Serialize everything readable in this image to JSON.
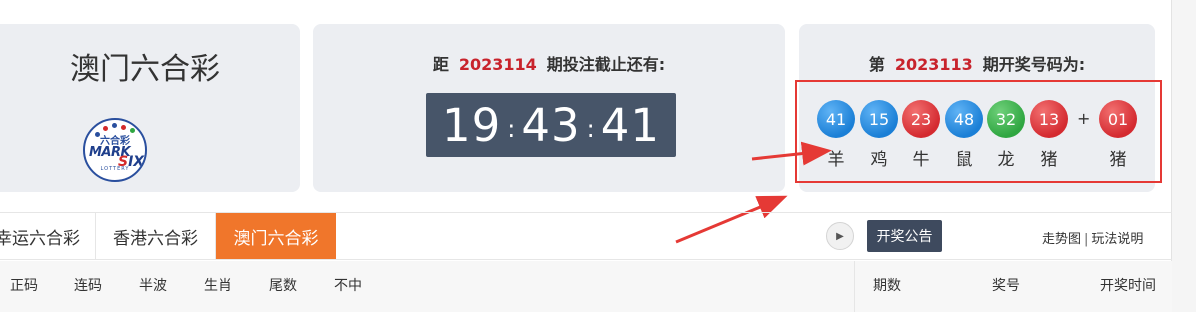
{
  "brand": {
    "title": "澳门六合彩",
    "logo_top": "六合彩",
    "logo_mark": "MARK",
    "logo_six_s": "S",
    "logo_six_rest": "IX",
    "logo_sub": "LOTTERY"
  },
  "countdown": {
    "prefix": "距",
    "issue": "2023114",
    "suffix": "期投注截止还有:",
    "hours": "19",
    "minutes": "43",
    "seconds": "41"
  },
  "result": {
    "prefix": "第",
    "issue": "2023113",
    "suffix": "期开奖号码为:",
    "plus": "+",
    "balls": [
      {
        "num": "41",
        "zodiac": "羊",
        "color": "blue"
      },
      {
        "num": "15",
        "zodiac": "鸡",
        "color": "blue"
      },
      {
        "num": "23",
        "zodiac": "牛",
        "color": "red"
      },
      {
        "num": "48",
        "zodiac": "鼠",
        "color": "blue"
      },
      {
        "num": "32",
        "zodiac": "龙",
        "color": "green"
      },
      {
        "num": "13",
        "zodiac": "猪",
        "color": "red"
      }
    ],
    "special": {
      "num": "01",
      "zodiac": "猪",
      "color": "red"
    }
  },
  "tabs": [
    {
      "label": "幸运六合彩",
      "active": false
    },
    {
      "label": "香港六合彩",
      "active": false
    },
    {
      "label": "澳门六合彩",
      "active": true
    }
  ],
  "toolbar": {
    "notice_label": "开奖公告",
    "trend_link": "走势图",
    "rules_link": "玩法说明",
    "separator": "|"
  },
  "subtabs": [
    "正码",
    "连码",
    "半波",
    "生肖",
    "尾数",
    "不中"
  ],
  "table_headers": [
    "期数",
    "奖号",
    "开奖时间"
  ],
  "colors": {
    "accent": "#f0762b",
    "timer_bg": "#475569",
    "highlight": "#e53935",
    "issue_red": "#c8232c"
  }
}
